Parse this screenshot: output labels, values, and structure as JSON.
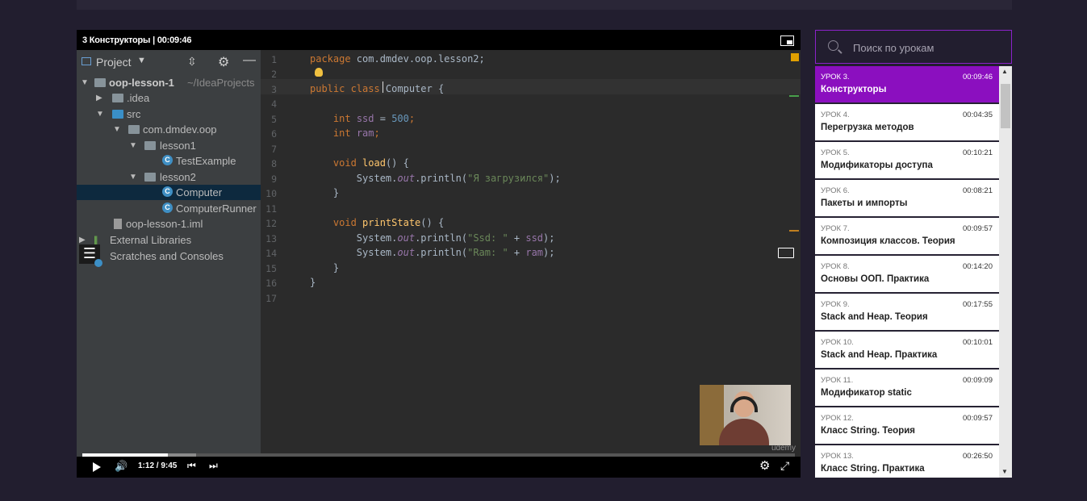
{
  "video": {
    "title": "3 Конструкторы | 00:09:46",
    "time": "1:12 / 9:45",
    "progress_played": 0.12,
    "progress_buffered": 0.16,
    "watermark": "ūdemy"
  },
  "ide": {
    "project_label": "Project",
    "tree": [
      {
        "label": "oop-lesson-1",
        "extra": "~/IdeaProjects"
      },
      {
        "label": ".idea"
      },
      {
        "label": "src"
      },
      {
        "label": "com.dmdev.oop"
      },
      {
        "label": "lesson1"
      },
      {
        "label": "TestExample"
      },
      {
        "label": "lesson2"
      },
      {
        "label": "Computer"
      },
      {
        "label": "ComputerRunner"
      },
      {
        "label": "oop-lesson-1.iml"
      },
      {
        "label": "External Libraries"
      },
      {
        "label": "Scratches and Consoles"
      }
    ],
    "line_numbers": [
      "1",
      "2",
      "3",
      "4",
      "5",
      "6",
      "7",
      "8",
      "9",
      "10",
      "11",
      "12",
      "13",
      "14",
      "15",
      "16",
      "17"
    ],
    "code": {
      "l1_kw": "package",
      "l1_rest": " com.dmdev.oop.lesson2;",
      "l3_kw": "public class",
      "l3_rest": " Computer {",
      "l5_kw": "int",
      "l5_fld": " ssd",
      "l5_eq": " = ",
      "l5_num": "500",
      "l5_end": ";",
      "l6_kw": "int",
      "l6_fld": " ram",
      "l6_end": ";",
      "l8_kw": "void",
      "l8_fn": " load",
      "l8_rest": "() {",
      "l9_a": "System.",
      "l9_out": "out",
      "l9_b": ".println(",
      "l9_str": "\"Я загрузился\"",
      "l9_c": ");",
      "l10": "}",
      "l12_kw": "void",
      "l12_fn": " printState",
      "l12_rest": "() {",
      "l13_a": "System.",
      "l13_out": "out",
      "l13_b": ".println(",
      "l13_str": "\"Ssd: \"",
      "l13_c": " + ",
      "l13_fld": "ssd",
      "l13_d": ");",
      "l14_a": "System.",
      "l14_out": "out",
      "l14_b": ".println(",
      "l14_str": "\"Ram: \"",
      "l14_c": " + ",
      "l14_fld": "ram",
      "l14_d": ");",
      "l15": "}",
      "l16": "}"
    }
  },
  "search": {
    "placeholder": "Поиск по урокам"
  },
  "lessons": [
    {
      "num": "УРОК 3.",
      "time": "00:09:46",
      "name": "Конструкторы",
      "active": true
    },
    {
      "num": "УРОК 4.",
      "time": "00:04:35",
      "name": "Перегрузка методов"
    },
    {
      "num": "УРОК 5.",
      "time": "00:10:21",
      "name": "Модификаторы доступа"
    },
    {
      "num": "УРОК 6.",
      "time": "00:08:21",
      "name": "Пакеты и импорты"
    },
    {
      "num": "УРОК 7.",
      "time": "00:09:57",
      "name": "Композиция классов. Теория"
    },
    {
      "num": "УРОК 8.",
      "time": "00:14:20",
      "name": "Основы ООП. Практика"
    },
    {
      "num": "УРОК 9.",
      "time": "00:17:55",
      "name": "Stack and Heap. Теория"
    },
    {
      "num": "УРОК 10.",
      "time": "00:10:01",
      "name": "Stack and Heap. Практика"
    },
    {
      "num": "УРОК 11.",
      "time": "00:09:09",
      "name": "Модификатор static"
    },
    {
      "num": "УРОК 12.",
      "time": "00:09:57",
      "name": "Класс String. Теория"
    },
    {
      "num": "УРОК 13.",
      "time": "00:26:50",
      "name": "Класс String. Практика"
    }
  ]
}
